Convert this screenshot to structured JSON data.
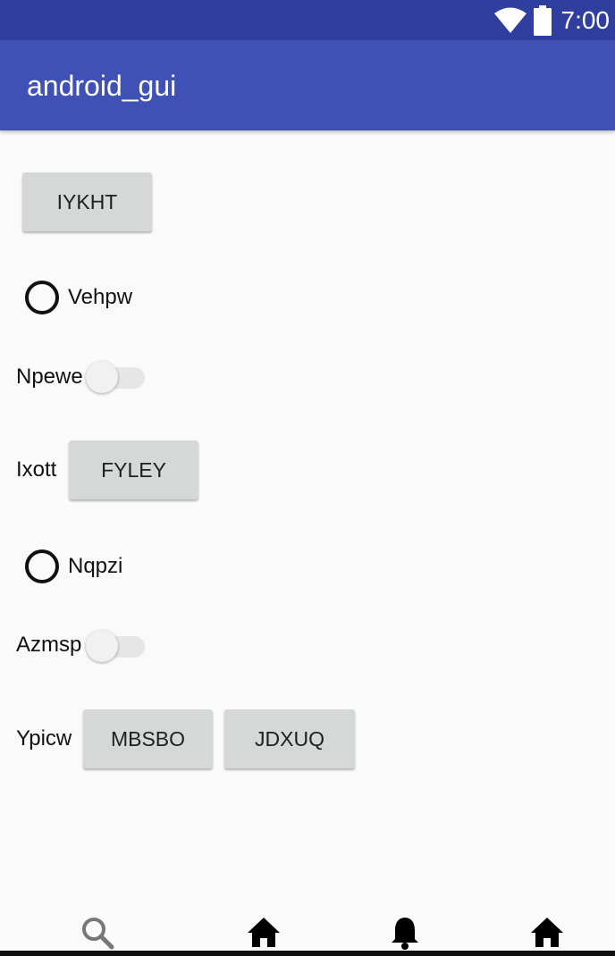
{
  "status_bar": {
    "time": "7:00",
    "icons": [
      "wifi-icon",
      "battery-icon"
    ]
  },
  "app_bar": {
    "title": "android_gui"
  },
  "main": {
    "button_1": "IYKHT",
    "radio_1": "Vehpw",
    "switch_1": {
      "label": "Npewe",
      "checked": false
    },
    "row_ixott": {
      "label": "Ixott",
      "button": "FYLEY"
    },
    "radio_2": "Nqpzi",
    "switch_2": {
      "label": "Azmsp",
      "checked": false
    },
    "row_ypicw": {
      "label": "Ypicw",
      "buttons": [
        "MBSBO",
        "JDXUQ"
      ]
    }
  },
  "bottom_nav": {
    "icons": [
      "search-icon",
      "home-icon",
      "bell-icon",
      "home-icon"
    ]
  },
  "colors": {
    "status_bar": "#303f9f",
    "app_bar": "#3f51b5",
    "background": "#fafafa",
    "button": "#d6d7d7"
  }
}
